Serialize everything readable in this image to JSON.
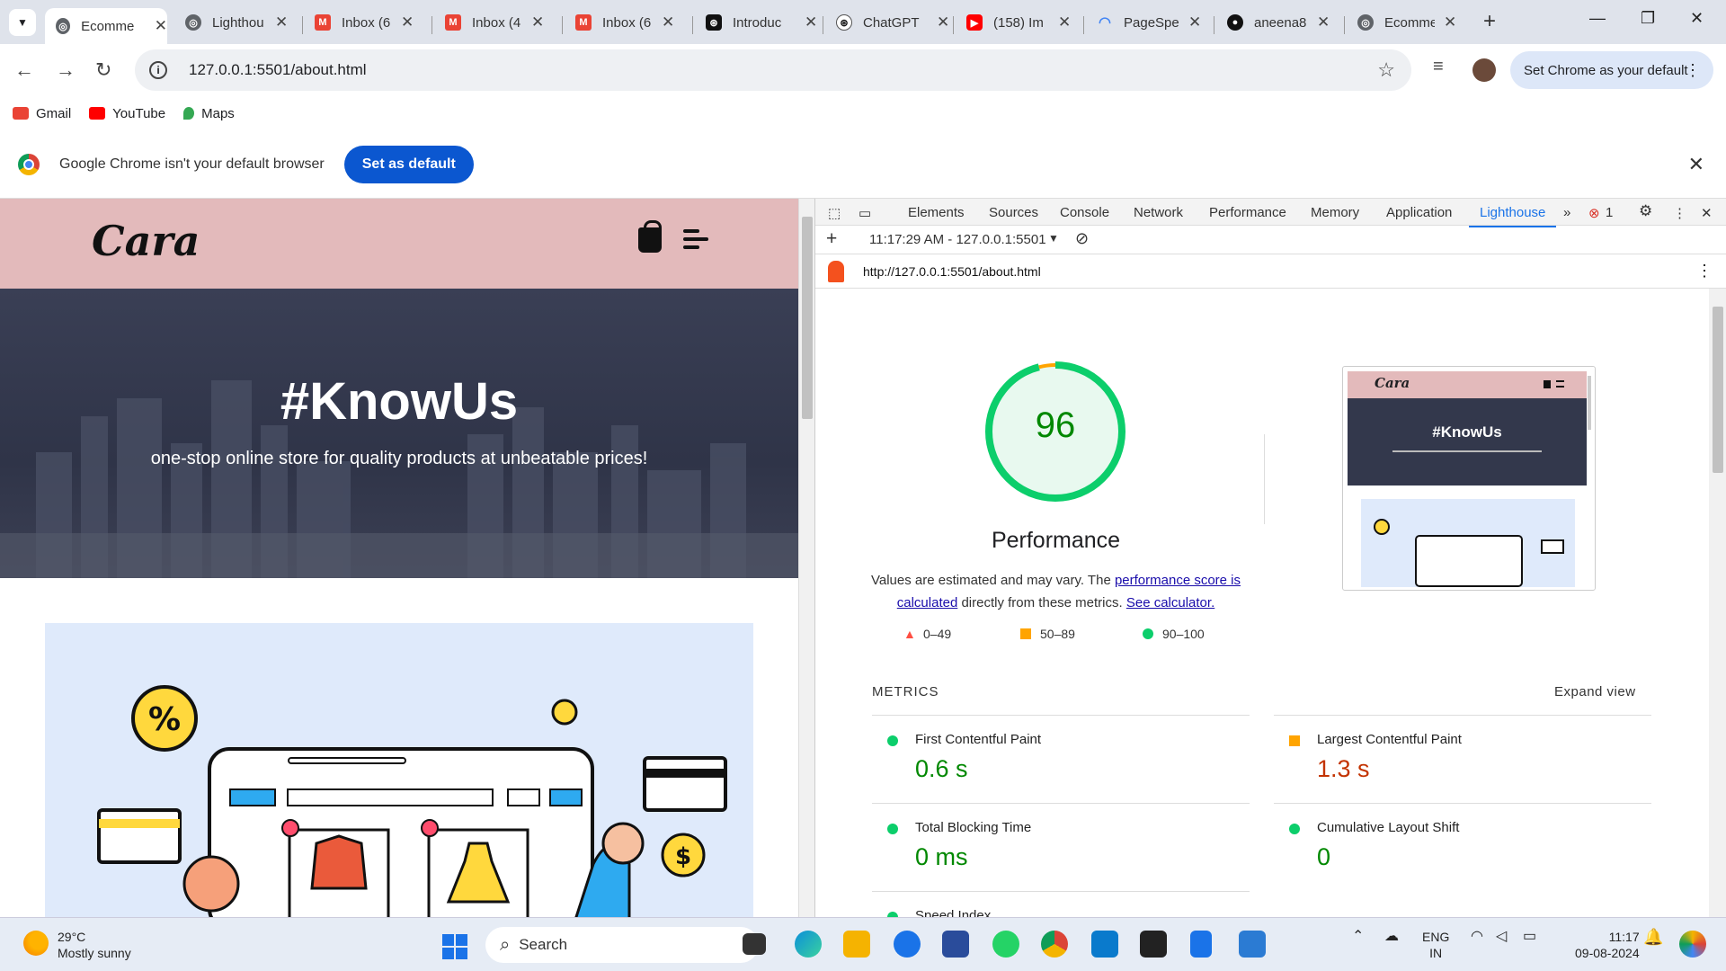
{
  "tabs": [
    {
      "label": "Ecomme",
      "icon": "globe-icon",
      "active": true
    },
    {
      "label": "Lighthou",
      "icon": "globe-icon"
    },
    {
      "label": "Inbox (6",
      "icon": "gmail-icon"
    },
    {
      "label": "Inbox (4",
      "icon": "gmail-icon"
    },
    {
      "label": "Inbox (6",
      "icon": "gmail-icon"
    },
    {
      "label": "Introduc",
      "icon": "openai-icon"
    },
    {
      "label": "ChatGPT",
      "icon": "openai-icon"
    },
    {
      "label": "(158) Im",
      "icon": "youtube-icon"
    },
    {
      "label": "PageSpe",
      "icon": "pagespeed-icon"
    },
    {
      "label": "aneena8",
      "icon": "github-icon"
    },
    {
      "label": "Ecomme",
      "icon": "globe-icon"
    }
  ],
  "toolbar": {
    "url": "127.0.0.1:5501/about.html",
    "set_default_label": "Set Chrome as your default"
  },
  "bookmarks": [
    {
      "label": "Gmail",
      "icon": "gmail-icon",
      "color": "#ea4335"
    },
    {
      "label": "YouTube",
      "icon": "youtube-icon",
      "color": "#ff0000"
    },
    {
      "label": "Maps",
      "icon": "maps-icon",
      "color": "#34a853"
    }
  ],
  "infobar": {
    "message": "Google Chrome isn't your default browser",
    "button": "Set as default"
  },
  "site": {
    "logo": "Cara",
    "hero_title": "#KnowUs",
    "hero_subtitle": "one-stop online store for quality products at unbeatable prices!"
  },
  "devtools": {
    "tabs": [
      "Elements",
      "Sources",
      "Console",
      "Network",
      "Performance",
      "Memory",
      "Application",
      "Lighthouse"
    ],
    "active_tab": "Lighthouse",
    "error_count": "1",
    "report_time": "11:17:29 AM - 127.0.0.1:5501",
    "report_url": "http://127.0.0.1:5501/about.html"
  },
  "lighthouse": {
    "score": "96",
    "score_fraction": 0.96,
    "category": "Performance",
    "note_prefix": "Values are estimated and may vary. The ",
    "note_link1": "performance score is calculated",
    "note_middle": " directly from these metrics. ",
    "note_link2": "See calculator.",
    "legend": [
      "0–49",
      "50–89",
      "90–100"
    ],
    "metrics_heading": "METRICS",
    "expand_label": "Expand view",
    "shot_title": "#KnowUs",
    "shot_logo": "Cara",
    "metrics": [
      {
        "name": "First Contentful Paint",
        "value": "0.6 s",
        "status": "pass"
      },
      {
        "name": "Largest Contentful Paint",
        "value": "1.3 s",
        "status": "average"
      },
      {
        "name": "Total Blocking Time",
        "value": "0 ms",
        "status": "pass"
      },
      {
        "name": "Cumulative Layout Shift",
        "value": "0",
        "status": "pass"
      },
      {
        "name": "Speed Index",
        "value": "",
        "status": "pass"
      }
    ],
    "colors": {
      "pass": "#0cce6b",
      "average": "#ffa400",
      "fail": "#ff4e42"
    }
  },
  "taskbar": {
    "temperature": "29°C",
    "weather": "Mostly sunny",
    "search_label": "Search",
    "lang1": "ENG",
    "lang2": "IN",
    "time": "11:17",
    "date": "09-08-2024"
  }
}
